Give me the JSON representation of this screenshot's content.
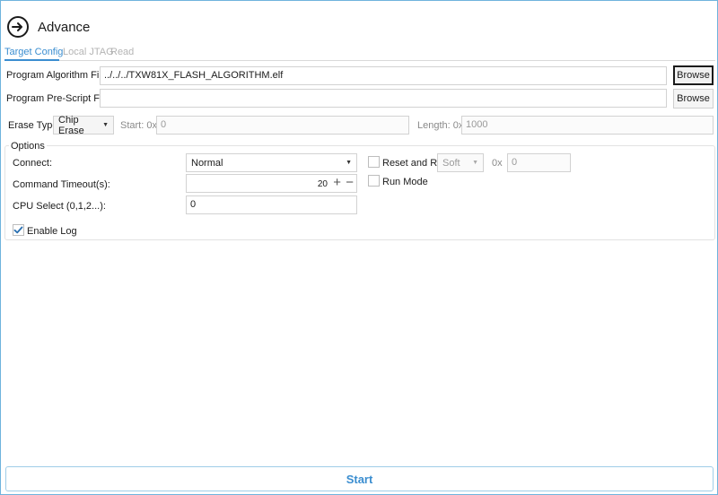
{
  "header": {
    "title": "Advance",
    "icon": "arrow-right-circle-icon"
  },
  "tabs": [
    {
      "label": "Target Config",
      "active": true
    },
    {
      "label": "Local JTAG",
      "active": false
    },
    {
      "label": "Read",
      "active": false
    }
  ],
  "program_algorithm": {
    "label": "Program Algorithm File :",
    "value": "../../../TXW81X_FLASH_ALGORITHM.elf",
    "browse_label": "Browse"
  },
  "pre_script": {
    "label": "Program Pre-Script File :",
    "value": "",
    "browse_label": "Browse"
  },
  "erase": {
    "type_label": "Erase Type",
    "type_value": "Chip Erase",
    "start_label": "Start: 0x",
    "start_value": "0",
    "length_label": "Length: 0x",
    "length_value": "1000"
  },
  "options": {
    "title": "Options",
    "connect_label": "Connect:",
    "connect_value": "Normal",
    "timeout_label": "Command Timeout(s):",
    "timeout_value": "20",
    "cpu_label": "CPU Select (0,1,2...):",
    "cpu_value": "0",
    "enable_log_label": "Enable Log",
    "enable_log_checked": true,
    "reset_run_label": "Reset and Run",
    "reset_run_checked": false,
    "reset_mode_value": "Soft",
    "reset_addr_label": "0x",
    "reset_addr_value": "0",
    "run_mode_label": "Run Mode",
    "run_mode_checked": false
  },
  "start_label": "Start",
  "colors": {
    "accent": "#3b8ed0",
    "border": "#6fb3dd"
  }
}
